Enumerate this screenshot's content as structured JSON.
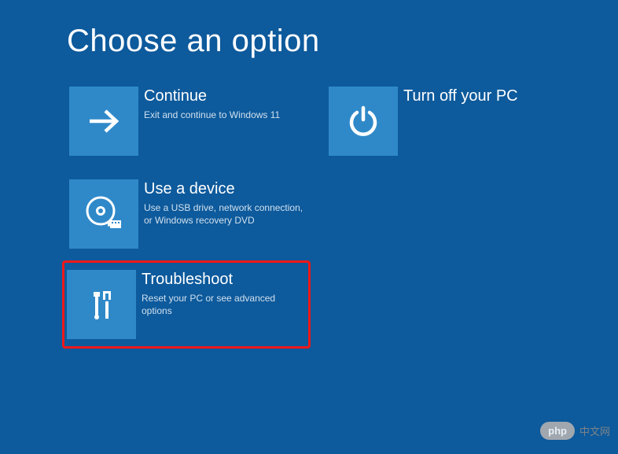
{
  "page_title": "Choose an option",
  "options": {
    "continue": {
      "title": "Continue",
      "desc": "Exit and continue to Windows 11",
      "icon": "arrow-right-icon"
    },
    "use_device": {
      "title": "Use a device",
      "desc": "Use a USB drive, network connection, or Windows recovery DVD",
      "icon": "disc-usb-icon"
    },
    "troubleshoot": {
      "title": "Troubleshoot",
      "desc": "Reset your PC or see advanced options",
      "icon": "tools-icon",
      "highlighted": true
    },
    "turn_off": {
      "title": "Turn off your PC",
      "desc": "",
      "icon": "power-icon"
    }
  },
  "watermark": {
    "badge": "php",
    "text": "中文网"
  },
  "colors": {
    "background": "#0d5a9c",
    "tile": "#2f89c9",
    "highlight_border": "#f01818"
  }
}
